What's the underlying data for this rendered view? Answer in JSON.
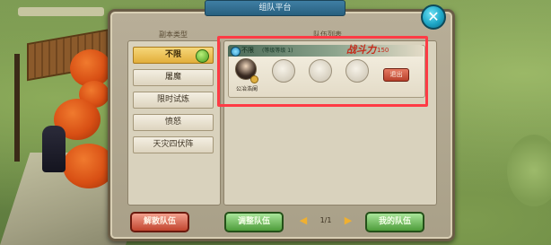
{
  "window": {
    "title": "组队平台"
  },
  "left_panel": {
    "header": "副本类型",
    "categories": [
      {
        "label": "不限",
        "active": true
      },
      {
        "label": "屠魔",
        "active": false
      },
      {
        "label": "限时试炼",
        "active": false
      },
      {
        "label": "愤怒",
        "active": false
      },
      {
        "label": "天灾四伏阵",
        "active": false
      }
    ]
  },
  "right_panel": {
    "header": "队伍列表",
    "team": {
      "mode": "不限",
      "level_requirement": "(等级等级 1)",
      "power_label": "战斗力",
      "power_value": "150",
      "leader_name": "公冶浩阑",
      "leave_label": "退出"
    }
  },
  "bottom_bar": {
    "dissolve_label": "解散队伍",
    "adjust_label": "调整队伍",
    "page_indicator": "1/1",
    "my_team_label": "我的队伍"
  },
  "colors": {
    "highlight": "#ff3b45",
    "active_tab": "#e2ae3a",
    "green_button": "#4e9c3b",
    "red_button": "#c2452f"
  }
}
